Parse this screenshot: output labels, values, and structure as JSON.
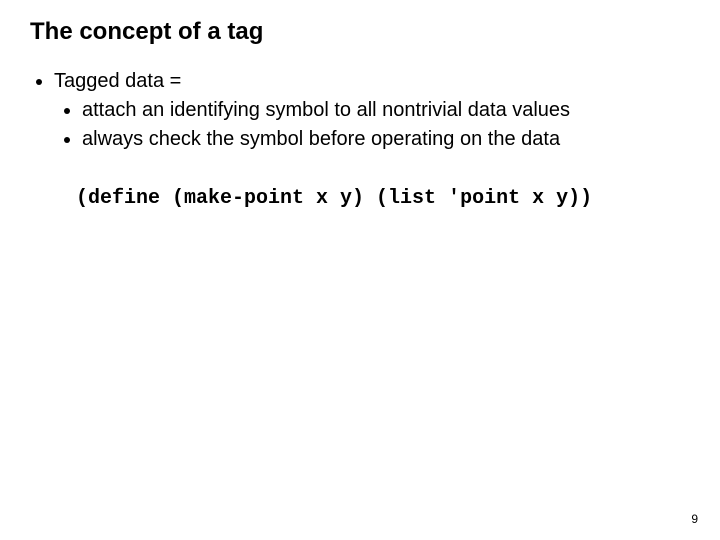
{
  "slide": {
    "title": "The concept of a tag",
    "bullets": {
      "main": "Tagged data =",
      "sub1": "attach an identifying symbol to all nontrivial data values",
      "sub2": "always check the symbol before operating on the data"
    },
    "code": "(define (make-point x y) (list 'point x y))",
    "page_number": "9"
  }
}
